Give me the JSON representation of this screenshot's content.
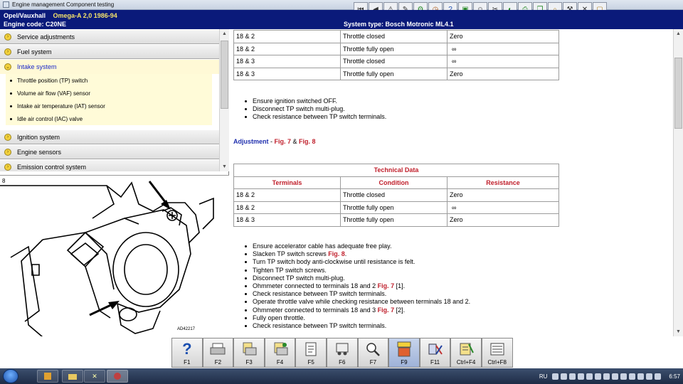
{
  "window": {
    "title": "Engine management Component testing"
  },
  "header": {
    "vehicle": "Opel/Vauxhall",
    "model": "Omega-A  2,0  1986-94",
    "engine_code": "Engine code: C20NE",
    "system_type": "System type: Bosch Motronic ML4.1"
  },
  "toolbar": {
    "icons": [
      "first-icon",
      "prev-icon",
      "warning-icon",
      "notes-icon",
      "settings-icon",
      "clock-icon",
      "help-icon",
      "image-icon",
      "user-icon",
      "tools-icon",
      "car-icon",
      "print-icon",
      "copy-icon",
      "search-icon",
      "wrench-icon",
      "close-icon",
      "cube-icon"
    ]
  },
  "menu": {
    "items": [
      {
        "label": "Service adjustments"
      },
      {
        "label": "Fuel system"
      },
      {
        "label": "Intake system"
      }
    ],
    "subitems": [
      {
        "label": "Throttle position (TP) switch"
      },
      {
        "label": "Volume air flow (VAF) sensor"
      },
      {
        "label": "Intake air temperature (IAT) sensor"
      },
      {
        "label": "Idle air control (IAC) valve"
      }
    ],
    "items_after": [
      {
        "label": "Ignition system"
      },
      {
        "label": "Engine sensors"
      },
      {
        "label": "Emission control system"
      }
    ]
  },
  "figure": {
    "number": "8",
    "code": "AD42217"
  },
  "table1": {
    "rows": [
      [
        "18 & 2",
        "Throttle closed",
        "Zero"
      ],
      [
        "18 & 2",
        "Throttle fully open",
        "∞"
      ],
      [
        "18 & 3",
        "Throttle closed",
        "∞"
      ],
      [
        "18 & 3",
        "Throttle fully open",
        "Zero"
      ]
    ]
  },
  "steps1": [
    "Ensure ignition switched OFF.",
    "Disconnect TP switch multi-plug.",
    "Check resistance between TP switch terminals."
  ],
  "adjustment": {
    "label": "Adjustment",
    "sep": " - ",
    "fig7": "Fig. 7",
    "amp": " & ",
    "fig8": "Fig. 8"
  },
  "table2": {
    "caption": "Technical Data",
    "headers": [
      "Terminals",
      "Condition",
      "Resistance"
    ],
    "rows": [
      [
        "18 & 2",
        "Throttle closed",
        "Zero"
      ],
      [
        "18 & 2",
        "Throttle fully open",
        "∞"
      ],
      [
        "18 & 3",
        "Throttle fully open",
        "Zero"
      ]
    ]
  },
  "steps2": {
    "s1": "Ensure accelerator cable has adequate free play.",
    "s2_pre": "Slacken TP switch screws ",
    "s2_ref": "Fig. 8",
    "s2_post": ".",
    "s3": "Turn TP switch body anti-clockwise until resistance is felt.",
    "s4": "Tighten TP switch screws.",
    "s5": "Disconnect TP switch multi-plug.",
    "s6_pre": "Ohmmeter connected to terminals 18 and 2 ",
    "s6_ref": "Fig. 7",
    "s6_post": " [1].",
    "s7": "Check resistance between TP switch terminals.",
    "s8": "Operate throttle valve while checking resistance between terminals 18 and 2.",
    "s9_pre": "Ohmmeter connected to terminals 18 and 3 ",
    "s9_ref": "Fig. 7",
    "s9_post": " [2].",
    "s10": "Fully open throttle.",
    "s11": "Check resistance between TP switch terminals."
  },
  "fkeys": [
    {
      "label": "F1",
      "icon": "help-icon"
    },
    {
      "label": "F2",
      "icon": "print-icon"
    },
    {
      "label": "F3",
      "icon": "print-preview-icon"
    },
    {
      "label": "F4",
      "icon": "print-page-icon"
    },
    {
      "label": "F5",
      "icon": "document-icon"
    },
    {
      "label": "F6",
      "icon": "truck-icon"
    },
    {
      "label": "F7",
      "icon": "zoom-icon"
    },
    {
      "label": "F9",
      "icon": "engine-icon"
    },
    {
      "label": "F11",
      "icon": "diagram-icon"
    },
    {
      "label": "Ctrl+F4",
      "icon": "notepad-icon"
    },
    {
      "label": "Ctrl+F8",
      "icon": "list-icon"
    }
  ],
  "taskbar": {
    "lang": "RU",
    "clock": "6:57"
  },
  "colors": {
    "header_bg": "#0a1a7a",
    "header_highlight": "#f5e36b",
    "accent_red": "#c0202c",
    "link_blue": "#1f2fae",
    "submenu_bg": "#fffbd8"
  }
}
